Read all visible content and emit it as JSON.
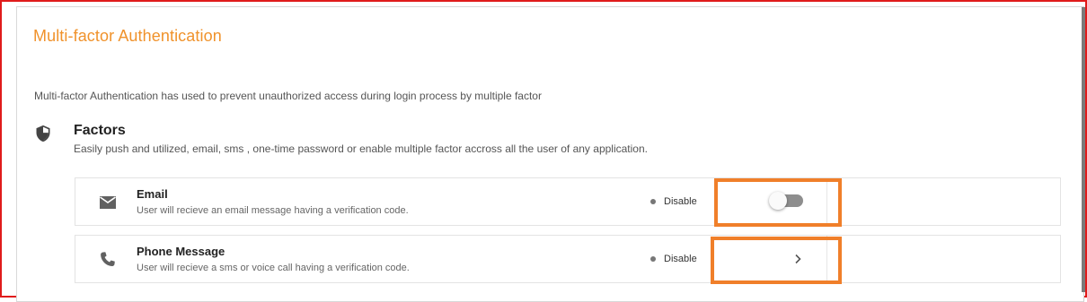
{
  "page": {
    "title": "Multi-factor Authentication",
    "description": "Multi-factor Authentication has used to prevent unauthorized access during login process by multiple factor"
  },
  "section": {
    "icon": "shield-icon",
    "title": "Factors",
    "description": "Easily push and utilized, email, sms , one-time password or enable multiple factor accross all the user of any application."
  },
  "factors": [
    {
      "icon": "mail-icon",
      "name": "Email",
      "description": "User will recieve an email message having a verification code.",
      "status": "Disable",
      "control": "toggle",
      "enabled": false
    },
    {
      "icon": "phone-icon",
      "name": "Phone Message",
      "description": "User will recieve a sms or voice call having a verification code.",
      "status": "Disable",
      "control": "chevron-right-icon"
    }
  ],
  "colors": {
    "accent": "#f0922b",
    "highlight_border": "#f07f2a",
    "frame_border": "#e01b1b",
    "status_dot": "#777777",
    "toggle_track": "#8e8e8e"
  }
}
